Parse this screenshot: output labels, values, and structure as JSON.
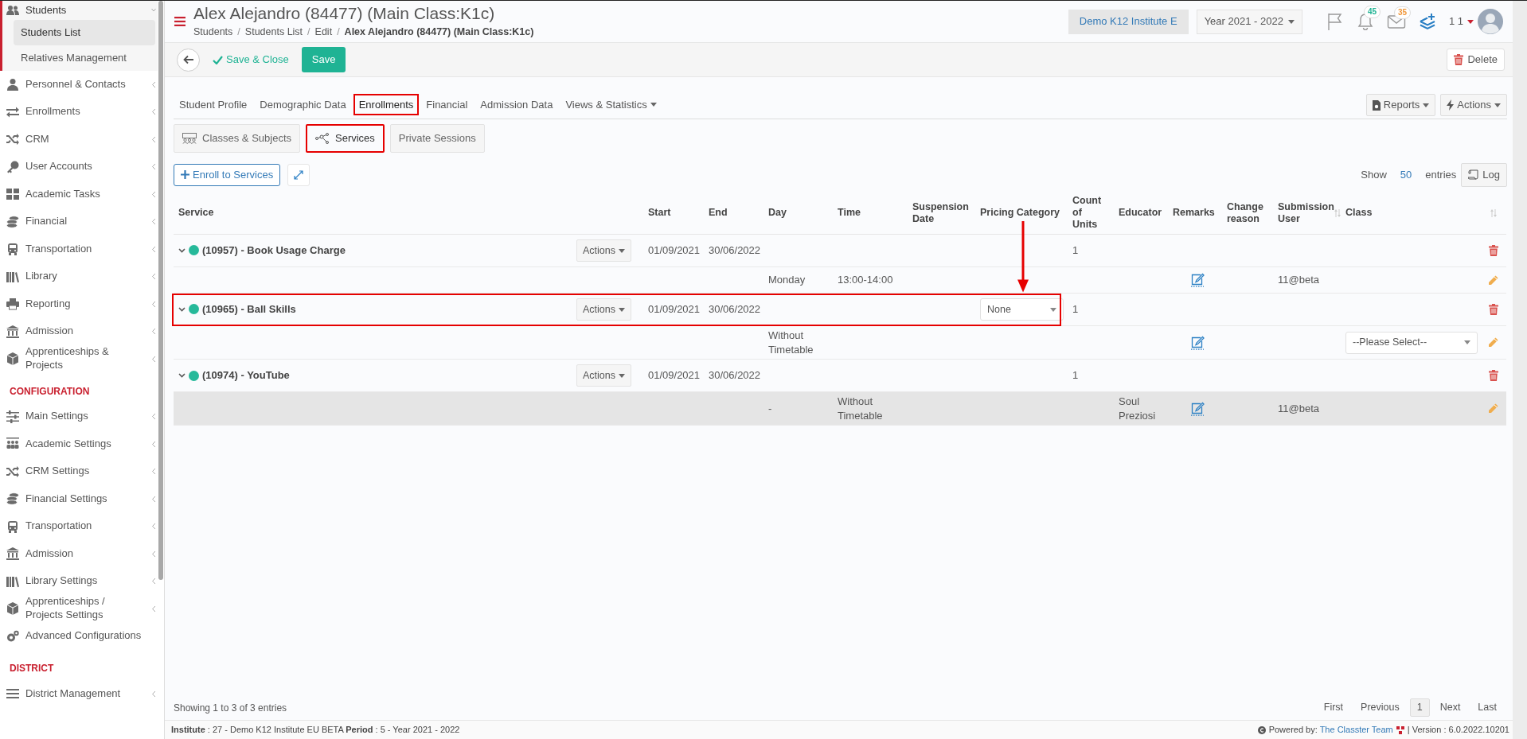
{
  "sidebar": {
    "items": [
      {
        "kind": "group",
        "label": "Students",
        "expanded": true,
        "submenu": true,
        "children": [
          {
            "label": "Students List",
            "selected": true
          },
          {
            "label": "Relatives Management",
            "selected": false
          }
        ]
      },
      {
        "kind": "item",
        "label": "Personnel & Contacts",
        "submenu": true
      },
      {
        "kind": "item",
        "label": "Enrollments",
        "submenu": true
      },
      {
        "kind": "item",
        "label": "CRM",
        "submenu": true
      },
      {
        "kind": "item",
        "label": "User Accounts",
        "submenu": true
      },
      {
        "kind": "item",
        "label": "Academic Tasks",
        "submenu": true
      },
      {
        "kind": "item",
        "label": "Financial",
        "submenu": true
      },
      {
        "kind": "item",
        "label": "Transportation",
        "submenu": true
      },
      {
        "kind": "item",
        "label": "Library",
        "submenu": true
      },
      {
        "kind": "item",
        "label": "Reporting",
        "submenu": true
      },
      {
        "kind": "item",
        "label": "Admission",
        "submenu": true
      },
      {
        "kind": "item",
        "label": "Apprenticeships & Projects",
        "submenu": true
      },
      {
        "kind": "heading",
        "label": "CONFIGURATION"
      },
      {
        "kind": "item",
        "label": "Main Settings",
        "submenu": true
      },
      {
        "kind": "item",
        "label": "Academic Settings",
        "submenu": true
      },
      {
        "kind": "item",
        "label": "CRM Settings",
        "submenu": true
      },
      {
        "kind": "item",
        "label": "Financial Settings",
        "submenu": true
      },
      {
        "kind": "item",
        "label": "Transportation",
        "submenu": true
      },
      {
        "kind": "item",
        "label": "Admission",
        "submenu": true
      },
      {
        "kind": "item",
        "label": "Library Settings",
        "submenu": true
      },
      {
        "kind": "item",
        "label": "Apprenticeships / Projects Settings",
        "submenu": true
      },
      {
        "kind": "item",
        "label": "Advanced Configurations",
        "submenu": false
      },
      {
        "kind": "heading",
        "label": "DISTRICT"
      },
      {
        "kind": "item",
        "label": "District Management",
        "submenu": true
      }
    ]
  },
  "header": {
    "title": "Alex Alejandro (84477) (Main Class:K1c)",
    "breadcrumb": [
      {
        "label": "Students",
        "current": false
      },
      {
        "label": "Students List",
        "current": false
      },
      {
        "label": "Edit",
        "current": false
      },
      {
        "label": "Alex Alejandro (84477) (Main Class:K1c)",
        "current": true
      }
    ],
    "separator": "/",
    "institute": "Demo K12 Institute E",
    "year": "Year 2021 - 2022",
    "notifications": "45",
    "messages": "35",
    "user": "1 1"
  },
  "toolbar": {
    "save_close": "Save & Close",
    "save": "Save",
    "delete": "Delete"
  },
  "tabs": [
    {
      "label": "Student Profile",
      "kind": "link",
      "selected": false,
      "highlighted": false
    },
    {
      "label": "Demographic Data",
      "kind": "link",
      "selected": false,
      "highlighted": false
    },
    {
      "label": "Enrollments",
      "kind": "link",
      "selected": true,
      "highlighted": true
    },
    {
      "label": "Financial",
      "kind": "link",
      "selected": false,
      "highlighted": false
    },
    {
      "label": "Admission Data",
      "kind": "link",
      "selected": false,
      "highlighted": false
    },
    {
      "label": "Views & Statistics",
      "kind": "dropdown",
      "selected": false,
      "highlighted": false
    }
  ],
  "tab_actions": [
    "Reports",
    "Actions"
  ],
  "subtabs": [
    {
      "label": "Classes & Subjects",
      "selected": false,
      "highlighted": false
    },
    {
      "label": "Services",
      "selected": true,
      "highlighted": true
    },
    {
      "label": "Private Sessions",
      "selected": false,
      "highlighted": false
    }
  ],
  "enroll_button": "Enroll to Services",
  "page_length": {
    "before": "Show",
    "value": "50",
    "after": "entries"
  },
  "log_button": "Log",
  "table": {
    "columns": [
      {
        "label": "Service",
        "sortable": false,
        "pointed": false
      },
      {
        "label": "Start",
        "sortable": false,
        "pointed": false
      },
      {
        "label": "End",
        "sortable": false,
        "pointed": false
      },
      {
        "label": "Day",
        "sortable": false,
        "pointed": false
      },
      {
        "label": "Time",
        "sortable": false,
        "pointed": false
      },
      {
        "label": "Suspension Date",
        "sortable": false,
        "pointed": false
      },
      {
        "label": "Pricing Category",
        "sortable": false,
        "pointed": true
      },
      {
        "label": "Count of Units",
        "sortable": false,
        "pointed": false
      },
      {
        "label": "Educator",
        "sortable": false,
        "pointed": false
      },
      {
        "label": "Remarks",
        "sortable": false,
        "pointed": false
      },
      {
        "label": "Change reason",
        "sortable": false,
        "pointed": false
      },
      {
        "label": "Submission User",
        "sortable": true,
        "pointed": false
      },
      {
        "label": "Class",
        "sortable": false,
        "pointed": false
      }
    ],
    "rows": [
      {
        "service": "(10957) - Book Usage Charge",
        "color": "#26b99a",
        "expanded": true,
        "highlighted": false,
        "actions": "Actions",
        "start": "01/09/2021",
        "end": "30/06/2022",
        "count": "1",
        "detail": {
          "selected": false,
          "day": "Monday",
          "time": "13:00-14:00",
          "submission_user": "11@beta"
        }
      },
      {
        "service": "(10965) - Ball Skills",
        "color": "#26b99a",
        "expanded": true,
        "highlighted": true,
        "actions": "Actions",
        "start": "01/09/2021",
        "end": "30/06/2022",
        "pricing": "None",
        "count": "1",
        "detail": {
          "selected": false,
          "day": "Without Timetable",
          "class_select": "--Please Select--"
        }
      },
      {
        "service": "(10974) - YouTube",
        "color": "#26b99a",
        "expanded": true,
        "highlighted": false,
        "actions": "Actions",
        "start": "01/09/2021",
        "end": "30/06/2022",
        "count": "1",
        "detail": {
          "selected": true,
          "day": "-",
          "time": "Without Timetable",
          "educator": "Soul Preziosi",
          "submission_user": "11@beta"
        }
      }
    ]
  },
  "info": "Showing 1 to 3 of 3 entries",
  "pagination": [
    {
      "label": "First",
      "selected": false
    },
    {
      "label": "Previous",
      "selected": false
    },
    {
      "label": "1",
      "selected": true
    },
    {
      "label": "Next",
      "selected": false
    },
    {
      "label": "Last",
      "selected": false
    }
  ],
  "status_bar": {
    "context": "**Institute** : 27 - Demo K12 Institute EU BETA **Period** : 5 - Year 2021 - 2022",
    "powered_by": "Powered by:",
    "team_link": "The Classter Team",
    "version": "| Version : 6.0.2022.10201"
  }
}
